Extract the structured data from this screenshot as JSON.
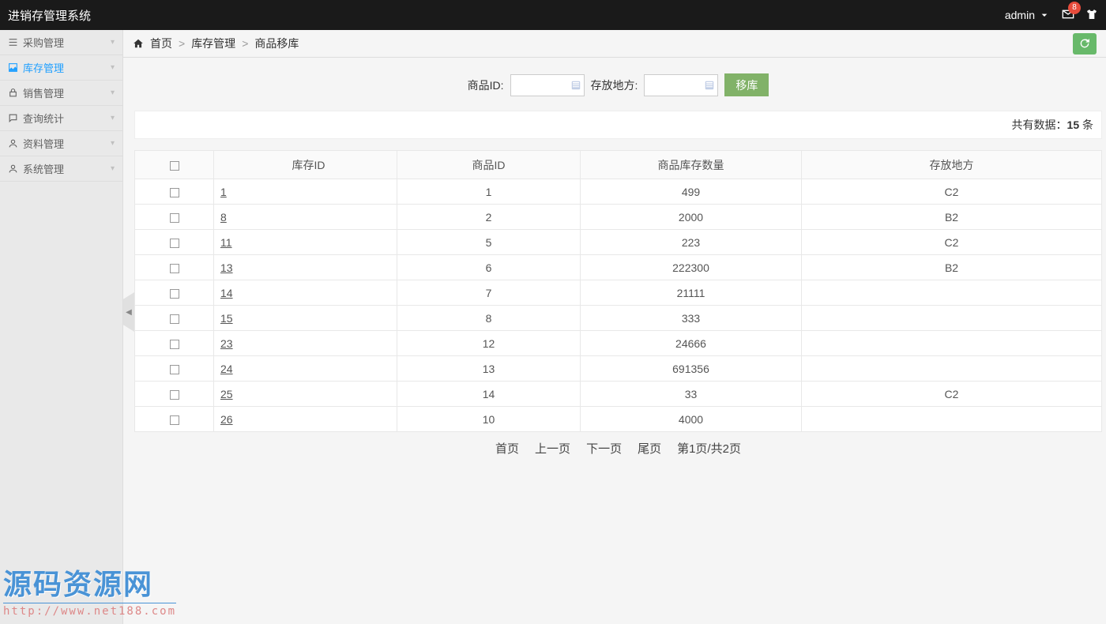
{
  "topbar": {
    "title": "进销存管理系统",
    "user": "admin",
    "badge": "8"
  },
  "sidebar": {
    "items": [
      {
        "label": "采购管理"
      },
      {
        "label": "库存管理"
      },
      {
        "label": "销售管理"
      },
      {
        "label": "查询统计"
      },
      {
        "label": "资料管理"
      },
      {
        "label": "系统管理"
      }
    ]
  },
  "crumb": {
    "home": "首页",
    "cat": "库存管理",
    "page": "商品移库"
  },
  "search": {
    "product_label": "商品ID:",
    "location_label": "存放地方:",
    "move_btn": "移库"
  },
  "count": {
    "prefix": "共有数据：",
    "num": "15",
    "suffix": " 条"
  },
  "table": {
    "headers": {
      "stock_id": "库存ID",
      "product_id": "商品ID",
      "qty": "商品库存数量",
      "location": "存放地方"
    },
    "rows": [
      {
        "stock_id": "1",
        "product_id": "1",
        "qty": "499",
        "location": "C2"
      },
      {
        "stock_id": "8",
        "product_id": "2",
        "qty": "2000",
        "location": "B2"
      },
      {
        "stock_id": "11",
        "product_id": "5",
        "qty": "223",
        "location": "C2"
      },
      {
        "stock_id": "13",
        "product_id": "6",
        "qty": "222300",
        "location": "B2"
      },
      {
        "stock_id": "14",
        "product_id": "7",
        "qty": "21111",
        "location": ""
      },
      {
        "stock_id": "15",
        "product_id": "8",
        "qty": "333",
        "location": ""
      },
      {
        "stock_id": "23",
        "product_id": "12",
        "qty": "24666",
        "location": ""
      },
      {
        "stock_id": "24",
        "product_id": "13",
        "qty": "691356",
        "location": ""
      },
      {
        "stock_id": "25",
        "product_id": "14",
        "qty": "33",
        "location": "C2"
      },
      {
        "stock_id": "26",
        "product_id": "10",
        "qty": "4000",
        "location": ""
      }
    ]
  },
  "pager": {
    "first": "首页",
    "prev": "上一页",
    "next": "下一页",
    "last": "尾页",
    "info": "第1页/共2页"
  },
  "watermark": {
    "main": "源码资源网",
    "url": "http://www.net188.com"
  }
}
